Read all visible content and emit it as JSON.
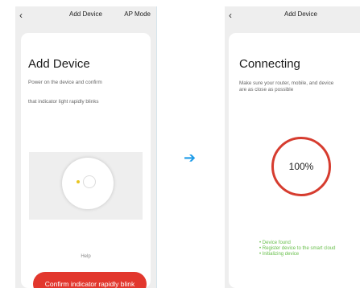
{
  "left_screen": {
    "back_label": "‹",
    "title": "Add Device",
    "right_action": "AP Mode",
    "heading": "Add Device",
    "instruction_line1": "Power on the device and confirm",
    "instruction_line2": "that indicator light rapidly blinks",
    "help_label": "Help",
    "confirm_button": "Confirm indicator rapidly blink"
  },
  "flow_arrow": "➔",
  "right_screen": {
    "back_label": "‹",
    "title": "Add Device",
    "heading": "Connecting",
    "instruction_line1": "Make sure your router, mobile, and device",
    "instruction_line2": "are as close as possible",
    "progress_percent": "100%",
    "steps": [
      "• Device found",
      "• Register device to the smart cloud",
      "• Initializing device"
    ]
  },
  "colors": {
    "accent_red": "#e2372d",
    "ring_red": "#d63c2f",
    "success_green": "#67bf4a",
    "arrow_blue": "#1e9be8",
    "indicator_yellow": "#e8c520"
  }
}
